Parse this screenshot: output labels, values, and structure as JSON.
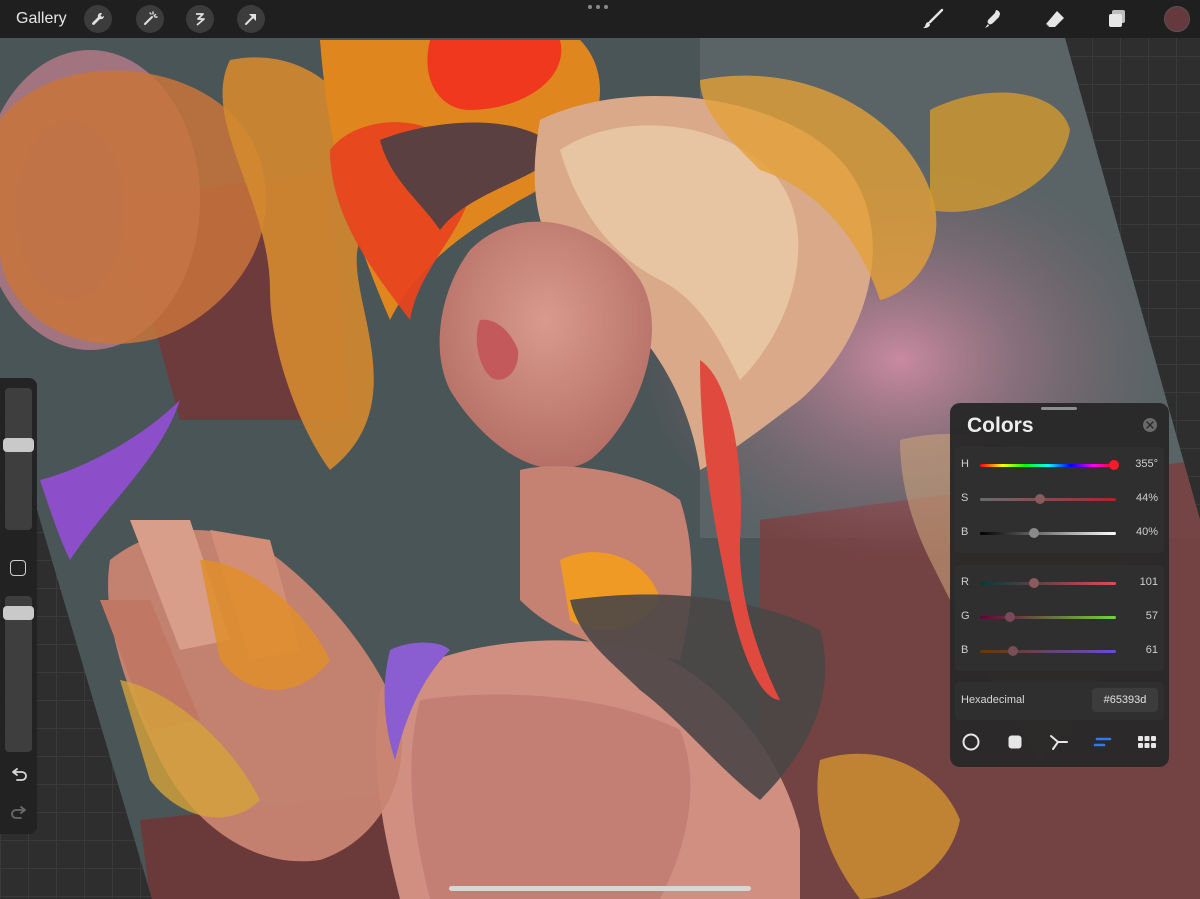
{
  "topbar": {
    "gallery_label": "Gallery",
    "actions": [
      "wrench-icon",
      "magic-wand-icon",
      "selection-icon",
      "transform-arrow-icon"
    ],
    "tools": [
      "brush-icon",
      "smudge-icon",
      "eraser-icon",
      "layers-icon"
    ],
    "current_color": "#65393d"
  },
  "sidebar": {
    "undo_icon": "undo-icon",
    "redo_icon": "redo-icon"
  },
  "colors_panel": {
    "title": "Colors",
    "hsb": [
      {
        "label": "H",
        "value": "355°",
        "fraction": 0.986
      },
      {
        "label": "S",
        "value": "44%",
        "fraction": 0.44
      },
      {
        "label": "B",
        "value": "40%",
        "fraction": 0.4
      }
    ],
    "rgb": [
      {
        "label": "R",
        "value": "101",
        "fraction": 0.396
      },
      {
        "label": "G",
        "value": "57",
        "fraction": 0.224
      },
      {
        "label": "B",
        "value": "61",
        "fraction": 0.239
      }
    ],
    "hex_label": "Hexadecimal",
    "hex_value": "#65393d",
    "modes": [
      "disc-icon",
      "classic-icon",
      "harmony-icon",
      "value-icon",
      "palettes-icon"
    ],
    "active_mode": "value-icon"
  }
}
